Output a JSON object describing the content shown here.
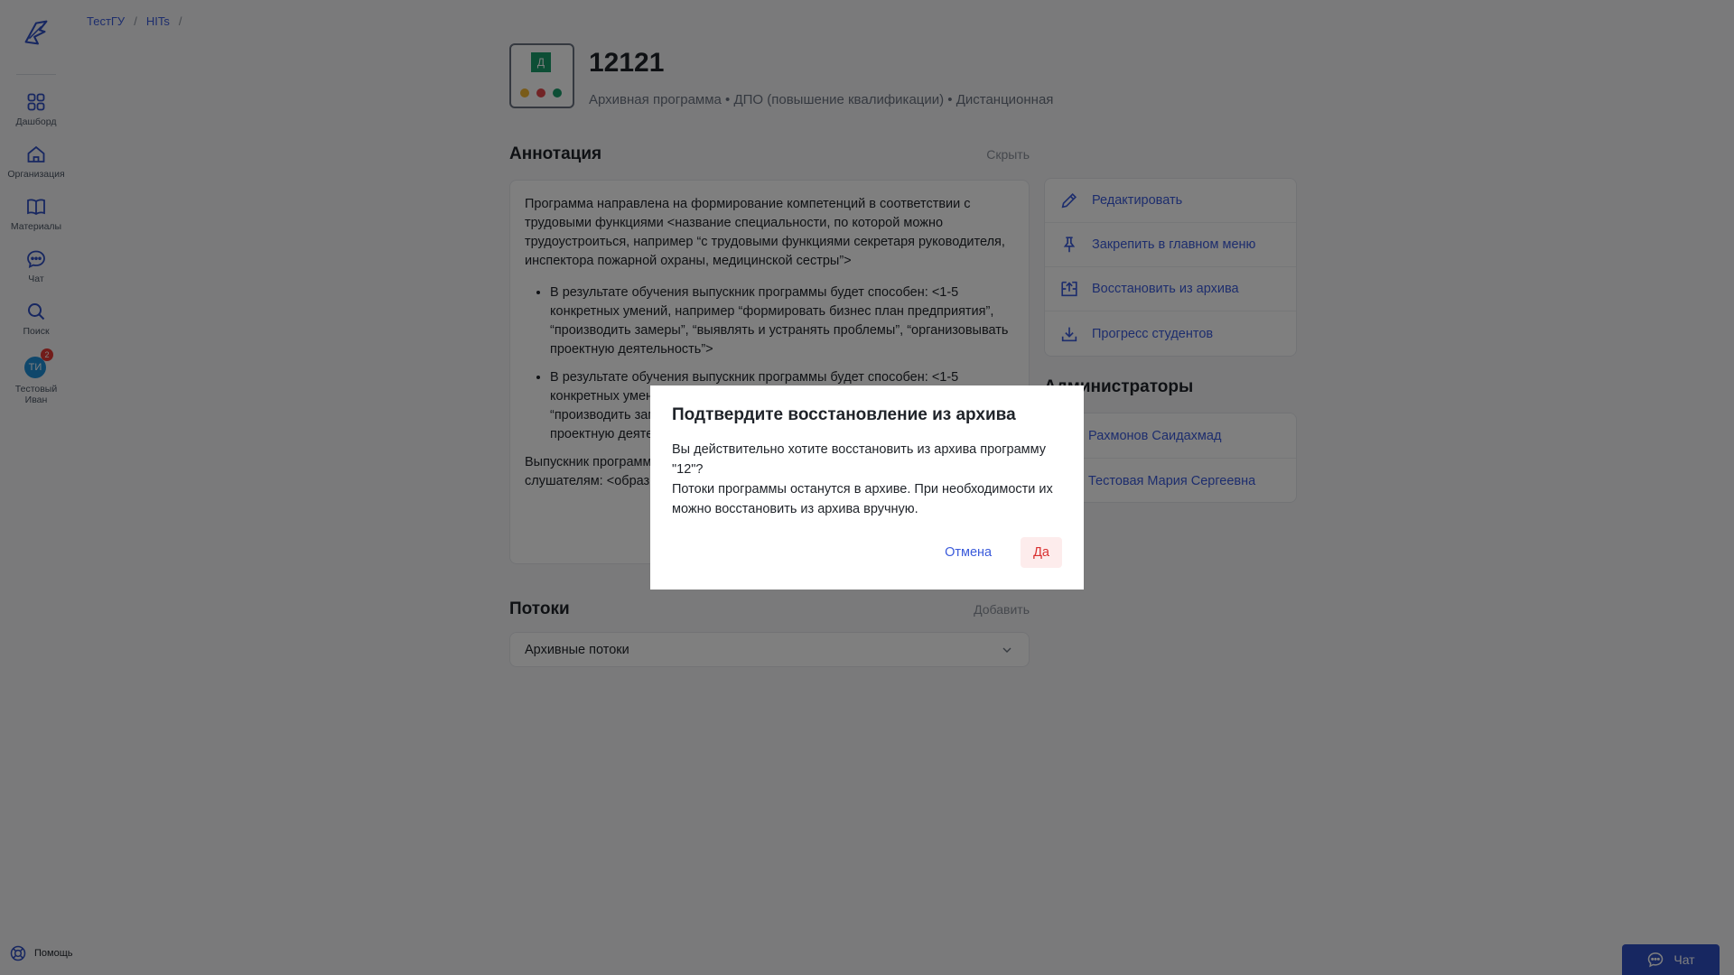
{
  "sidebar": {
    "items": [
      {
        "label": "Дашборд",
        "icon": "grid-icon"
      },
      {
        "label": "Организация",
        "icon": "home-icon"
      },
      {
        "label": "Материалы",
        "icon": "book-icon"
      },
      {
        "label": "Чат",
        "icon": "chat-icon"
      },
      {
        "label": "Поиск",
        "icon": "search-icon"
      }
    ],
    "user": {
      "initials": "ТИ",
      "name": "Тестовый Иван",
      "badge": "2"
    },
    "help_label": "Помощь"
  },
  "breadcrumb": {
    "items": [
      "ТестГУ",
      "HITs"
    ],
    "separator": "/"
  },
  "program": {
    "title": "12121",
    "subtitle": "Архивная программа • ДПО (повышение квалификации) • Дистанционная",
    "cover_letter": "Д"
  },
  "annotation": {
    "title": "Аннотация",
    "action": "Скрыть",
    "paragraph": "Программа направлена на формирование компетенций в соответствии с трудовыми функциями <название специальности, по которой можно трудоустроиться, например “с трудовыми функциями секретаря руководителя, инспектора пожарной охраны, медицинской сестры”>",
    "bullets": [
      "В результате обучения выпускник программы будет способен: <1-5 конкретных умений, например “формировать бизнес план предприятия”, “производить замеры”, “выявлять и устранять проблемы”, “организовывать проектную деятельность”>",
      "В результате обучения выпускник программы будет способен: <1-5 конкретных умений, например “формировать бизнес план предприятия”, “производить замеры”, “выявлять и устранять проблемы”, “организовывать проектную деятельность”>"
    ],
    "tail": "Выпускник программы ... Заполняется в случае ... ходе стажировки на ... слушателям: <образ... считаете важным, н..."
  },
  "actions": [
    {
      "label": "Редактировать",
      "icon": "pencil-icon"
    },
    {
      "label": "Закрепить в главном меню",
      "icon": "pin-icon"
    },
    {
      "label": "Восстановить из архива",
      "icon": "unarchive-icon"
    },
    {
      "label": "Прогресс студентов",
      "icon": "download-icon"
    }
  ],
  "admins": {
    "title": "Администраторы",
    "items": [
      "Рахмонов Саидахмад",
      "Тестовая Мария Сергеевна"
    ]
  },
  "streams": {
    "title": "Потоки",
    "action": "Добавить",
    "archived_label": "Архивные потоки"
  },
  "chat_fab": {
    "label": "Чат"
  },
  "modal": {
    "title": "Подтвердите восстановление из архива",
    "line1": "Вы действительно хотите восстановить из архива программу \"12\"?",
    "line2": "Потоки программы останутся в архиве. При необходимости их можно восстановить из архива вручную.",
    "cancel": "Отмена",
    "confirm": "Да"
  },
  "colors": {
    "accent": "#3b5bdb",
    "danger": "#d93030",
    "brand": "#2f4ec2"
  }
}
